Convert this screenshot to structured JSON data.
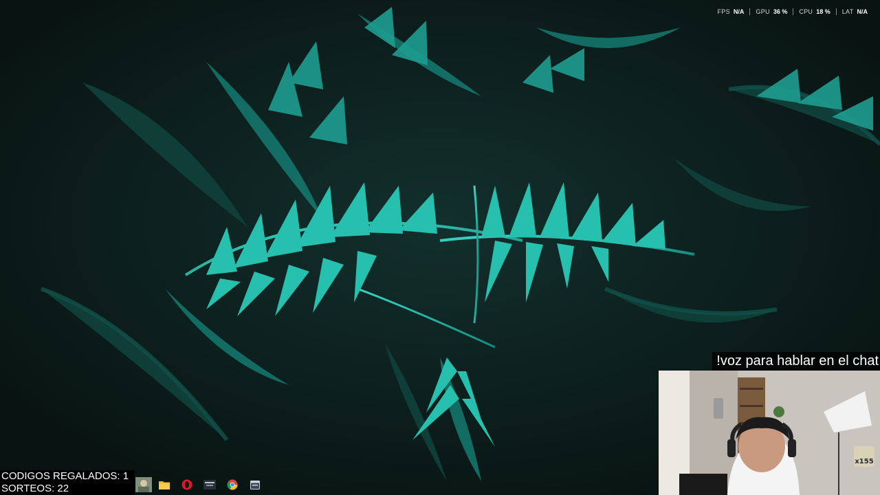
{
  "performance_overlay": {
    "items": [
      {
        "label": "FPS",
        "value": "N/A"
      },
      {
        "label": "GPU",
        "value": "36 %"
      },
      {
        "label": "CPU",
        "value": "18 %"
      },
      {
        "label": "LAT",
        "value": "N/A"
      }
    ]
  },
  "chat_overlay": {
    "text": "!voz para hablar en el chat"
  },
  "webcam": {
    "badge_text": "x155"
  },
  "stats_overlay": {
    "line1": "CODIGOS REGALADOS: 1",
    "line2": "SORTEOS: 22"
  },
  "taskbar": {
    "icons": [
      "app-thumbnail-icon",
      "file-explorer-icon",
      "opera-icon",
      "game-launcher-icon",
      "chrome-icon",
      "window-app-icon"
    ]
  },
  "colors": {
    "fern": "#1fa89a",
    "background": "#0d1716",
    "overlay_bg": "#000000"
  }
}
